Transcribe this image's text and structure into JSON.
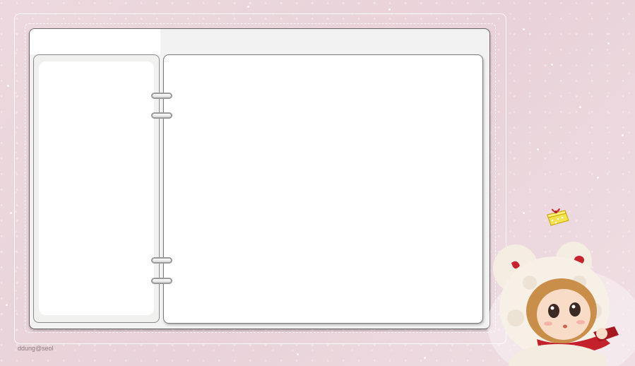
{
  "watermark": "ddung@seol",
  "colors": {
    "background": "#ead4da",
    "panel": "#ffffff",
    "border": "#7a7a7a",
    "ring": "#9a9a9a"
  },
  "decor": {
    "character": "doll-illustration",
    "gift": "gift-box-icon"
  }
}
